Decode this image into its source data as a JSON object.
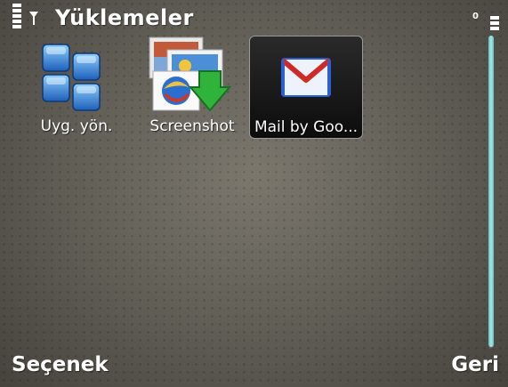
{
  "status_bar": {
    "title": "Yüklemeler",
    "battery_text": "0",
    "icons": [
      "signal-strength-icon",
      "antenna-icon",
      "battery-level-icon"
    ]
  },
  "apps": [
    {
      "label": "Uyg. yön.",
      "icon": "app-manager-icon"
    },
    {
      "label": "Screenshot",
      "icon": "screenshot-app-icon"
    },
    {
      "label": "Mail by Goo...",
      "icon": "gmail-envelope-icon",
      "selected": true
    }
  ],
  "softkeys": {
    "left": "Seçenek",
    "right": "Geri"
  },
  "colors": {
    "scrollbar": "#8fd8d6",
    "selection": "#111111",
    "gmail_blue": "#2c5fd0",
    "gmail_red": "#d02a26"
  }
}
